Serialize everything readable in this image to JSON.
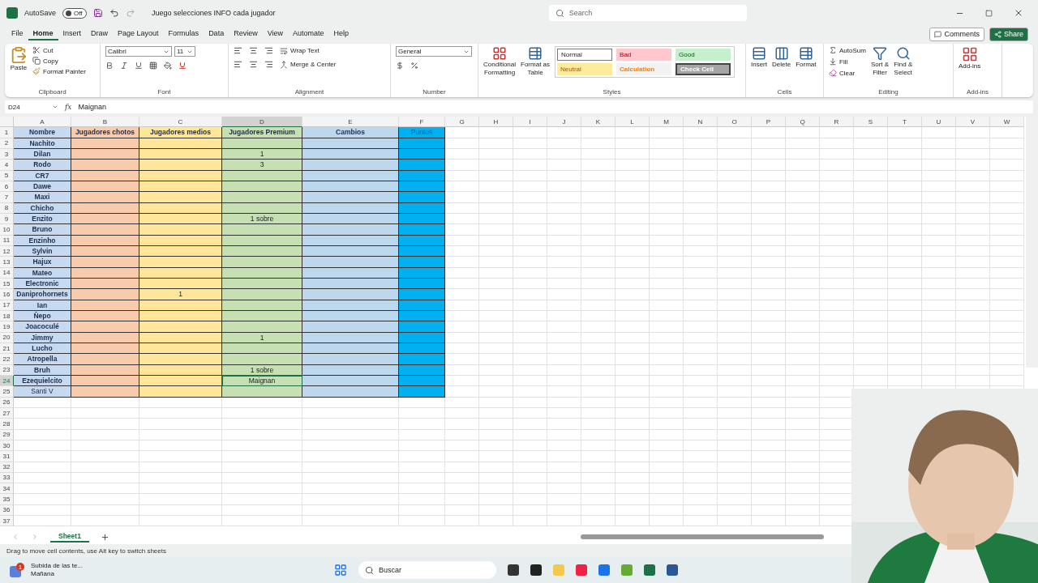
{
  "title_bar": {
    "autosave_label": "AutoSave",
    "autosave_state": "Off",
    "autosave_on": false,
    "document_title": "Juego selecciones INFO cada jugador",
    "search_placeholder": "Search"
  },
  "menu_tabs": [
    {
      "label": "File",
      "selected": false
    },
    {
      "label": "Home",
      "selected": true
    },
    {
      "label": "Insert",
      "selected": false
    },
    {
      "label": "Draw",
      "selected": false
    },
    {
      "label": "Page Layout",
      "selected": false
    },
    {
      "label": "Formulas",
      "selected": false
    },
    {
      "label": "Data",
      "selected": false
    },
    {
      "label": "Review",
      "selected": false
    },
    {
      "label": "View",
      "selected": false
    },
    {
      "label": "Automate",
      "selected": false
    },
    {
      "label": "Help",
      "selected": false
    }
  ],
  "header_buttons": {
    "comments": "Comments",
    "share": "Share"
  },
  "ribbon": {
    "clipboard": {
      "title": "Clipboard",
      "paste": "Paste",
      "cut": "Cut",
      "copy": "Copy",
      "format_painter": "Format Painter"
    },
    "font": {
      "title": "Font",
      "family": "Calibri",
      "size": "11"
    },
    "alignment": {
      "title": "Alignment",
      "wrap_text": "Wrap Text",
      "merge": "Merge & Center"
    },
    "number": {
      "title": "Number",
      "format": "General"
    },
    "styles": {
      "title": "Styles",
      "conditional": [
        "Conditional",
        "Formatting"
      ],
      "format_table": [
        "Format as",
        "Table"
      ],
      "cell_styles": [
        {
          "label": "Normal",
          "color": "#ffffff"
        },
        {
          "label": "Bad",
          "color": "#ffc7ce"
        },
        {
          "label": "Good",
          "color": "#c6efce"
        },
        {
          "label": "Neutral",
          "color": "#ffeb9c"
        },
        {
          "label": "Calculation",
          "color": "#f2f2f2"
        },
        {
          "label": "Check Cell",
          "color": "#a5a5a5"
        }
      ]
    },
    "cells": {
      "title": "Cells",
      "buttons": [
        "Insert",
        "Delete",
        "Format"
      ]
    },
    "editing": {
      "title": "Editing",
      "autosum": "AutoSum",
      "fill": "Fill",
      "clear": "Clear",
      "sort": [
        "Sort &",
        "Filter"
      ],
      "find": [
        "Find &",
        "Select"
      ]
    },
    "addins": {
      "title": "Add-ins",
      "button": "Add-ins"
    }
  },
  "formula_bar": {
    "name_box": "D24",
    "fx": "fx",
    "value": "Maignan"
  },
  "columns": [
    {
      "letter": "A",
      "heading": "Nombre",
      "color": "#c5d9f1",
      "selected": false
    },
    {
      "letter": "B",
      "heading": "Jugadores chotos",
      "color": "#f8cbad",
      "selected": false
    },
    {
      "letter": "C",
      "heading": "Jugadores medios",
      "color": "#ffe699",
      "selected": false
    },
    {
      "letter": "D",
      "heading": "Jugadores Premium",
      "color": "#c6e0b4",
      "selected": true
    },
    {
      "letter": "E",
      "heading": "Cambios",
      "color": "#bdd7ee",
      "selected": false
    },
    {
      "letter": "F",
      "heading": "Puntos",
      "color": "#00b0f0",
      "selected": false
    }
  ],
  "extra_columns": [
    "G",
    "H",
    "I",
    "J",
    "K",
    "L",
    "M",
    "N",
    "O",
    "P",
    "Q",
    "R",
    "S",
    "T",
    "U",
    "V",
    "W"
  ],
  "header_row_number": "1",
  "rows": [
    {
      "number": "2",
      "name": "Nachito",
      "bold": true,
      "selected": false
    },
    {
      "number": "3",
      "name": "Dilan",
      "bold": true,
      "selected": false,
      "premium": "1"
    },
    {
      "number": "4",
      "name": "Rodo",
      "bold": true,
      "selected": false,
      "premium": "3"
    },
    {
      "number": "5",
      "name": "CR7",
      "bold": true,
      "selected": false
    },
    {
      "number": "6",
      "name": "Dawe",
      "bold": true,
      "selected": false
    },
    {
      "number": "7",
      "name": "Maxi",
      "bold": true,
      "selected": false
    },
    {
      "number": "8",
      "name": "Chicho",
      "bold": true,
      "selected": false
    },
    {
      "number": "9",
      "name": "Enzito",
      "bold": true,
      "selected": false,
      "premium": "1 sobre"
    },
    {
      "number": "10",
      "name": "Bruno",
      "bold": true,
      "selected": false
    },
    {
      "number": "11",
      "name": "Enzinho",
      "bold": true,
      "selected": false
    },
    {
      "number": "12",
      "name": "Sylvin",
      "bold": true,
      "selected": false
    },
    {
      "number": "13",
      "name": "Hajux",
      "bold": true,
      "selected": false
    },
    {
      "number": "14",
      "name": "Mateo",
      "bold": true,
      "selected": false
    },
    {
      "number": "15",
      "name": "Electronic",
      "bold": true,
      "selected": false
    },
    {
      "number": "16",
      "name": "Daniprohornets",
      "bold": true,
      "selected": false,
      "medios": "1"
    },
    {
      "number": "17",
      "name": "Ian",
      "bold": true,
      "selected": false
    },
    {
      "number": "18",
      "name": "Ñepo",
      "bold": true,
      "selected": false
    },
    {
      "number": "19",
      "name": "Joacoculé",
      "bold": true,
      "selected": false
    },
    {
      "number": "20",
      "name": "Jimmy",
      "bold": true,
      "selected": false,
      "premium": "1"
    },
    {
      "number": "21",
      "name": "Lucho",
      "bold": true,
      "selected": false
    },
    {
      "number": "22",
      "name": "Atropella",
      "bold": true,
      "selected": false
    },
    {
      "number": "23",
      "name": "Bruh",
      "bold": true,
      "selected": false,
      "premium": "1 sobre"
    },
    {
      "number": "24",
      "name": "Ezequielcito",
      "bold": true,
      "selected": true,
      "premium": "Maignan"
    },
    {
      "number": "25",
      "name": "Santi V",
      "bold": false,
      "selected": false
    }
  ],
  "empty_rows": [
    "26",
    "27",
    "28",
    "29",
    "30",
    "31",
    "32",
    "33",
    "34",
    "35",
    "36",
    "37"
  ],
  "sheet_tabs": [
    {
      "label": "Sheet1",
      "selected": true
    }
  ],
  "status_bar": "Drag to move cell contents, use Alt key to switch sheets",
  "taskbar": {
    "notification": {
      "title": "Subida de las te...",
      "subtitle": "Mañana",
      "badge": "1"
    },
    "search": "Buscar"
  }
}
